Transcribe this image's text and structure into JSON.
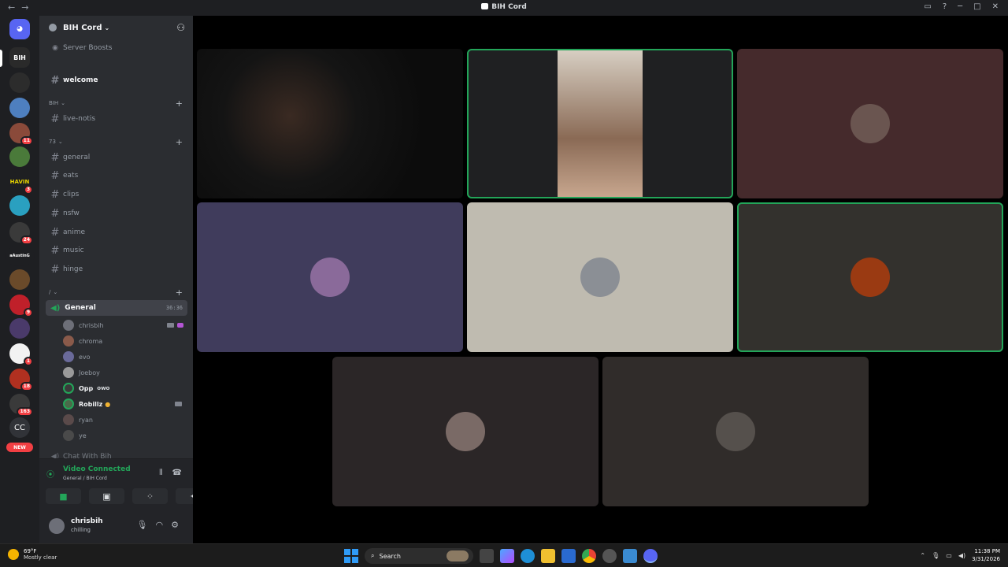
{
  "titlebar": {
    "title": "BIH Cord",
    "back": "←",
    "forward": "→"
  },
  "server": {
    "name": "BIH Cord",
    "server_boosts": "Server Boosts"
  },
  "channels": {
    "welcome": "welcome",
    "cat_bih": "BIH",
    "live_notis": "live-notis",
    "cat_73": "73",
    "general": "general",
    "eats": "eats",
    "clips": "clips",
    "nsfw": "nsfw",
    "anime": "anime",
    "music": "music",
    "hinge": "hinge",
    "cat_slash": "/",
    "voice_general": "General",
    "voice_timer": "36:36",
    "voice_users": [
      "chrisbih",
      "chroma",
      "evo",
      "Joeboy",
      "Opp",
      "Robillz",
      "ryan",
      "ye"
    ],
    "opp_tag": "owo",
    "chat_with_bih": "Chat With Bih"
  },
  "server_badges": {
    "s5": "11",
    "s7": "3",
    "s9": "24",
    "s13": "9",
    "s15": "1",
    "s16": "18",
    "s17": "163"
  },
  "server_labels": {
    "cc": "CC",
    "new": "NEW",
    "bih": "BIH",
    "havin": "HAVIN",
    "austin": "aAustinG"
  },
  "voice_panel": {
    "status": "Video Connected",
    "sub": "General / BIH Cord"
  },
  "user_panel": {
    "username": "chrisbih",
    "status": "chilling"
  },
  "taskbar": {
    "temp": "69°F",
    "weather": "Mostly clear",
    "search": "Search",
    "time": "11:38 PM",
    "date": "3/31/2026"
  },
  "colors": {
    "speaking": "#23a559",
    "rail": "#1e1f22",
    "sidebar": "#2b2d31",
    "mention": "#f23f43"
  },
  "tiles": [
    {
      "name": "video-tile-1",
      "bg": "#1a1a1c",
      "avatar": false
    },
    {
      "name": "video-tile-2",
      "bg": "#1f2022",
      "avatar": false,
      "speaking": true
    },
    {
      "name": "participant-tile-3",
      "bg": "#452a2c",
      "avatar": true,
      "avatar_color": "#6a5550"
    },
    {
      "name": "participant-tile-4",
      "bg": "#403c5c",
      "avatar": true,
      "avatar_color": "#8a6a9a"
    },
    {
      "name": "participant-tile-5",
      "bg": "#bfbbb0",
      "avatar": true,
      "avatar_color": "#8b8f95"
    },
    {
      "name": "participant-tile-6",
      "bg": "#33312d",
      "avatar": true,
      "avatar_color": "#9a3a12",
      "speaking": true
    },
    {
      "name": "participant-tile-7",
      "bg": "#2b2627",
      "avatar": true,
      "avatar_color": "#7a6a66"
    },
    {
      "name": "participant-tile-8",
      "bg": "#302c2a",
      "avatar": true,
      "avatar_color": "#55504c"
    }
  ]
}
